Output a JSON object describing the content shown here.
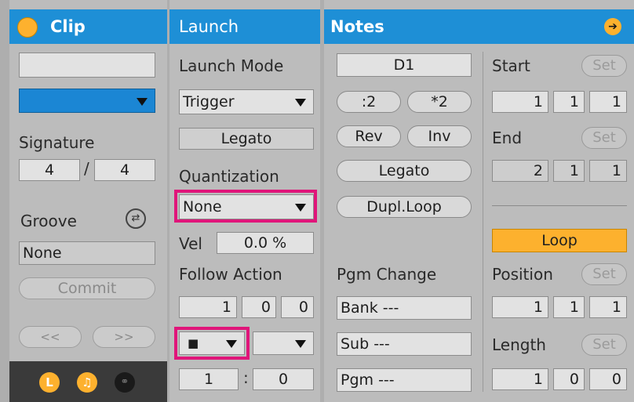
{
  "clip": {
    "title": "Clip",
    "name_value": "",
    "color_value": "",
    "signature_label": "Signature",
    "sig_num": "4",
    "sig_sep": "/",
    "sig_den": "4",
    "groove_label": "Groove",
    "groove_value": "None",
    "commit_label": "Commit",
    "nav_back": "<<",
    "nav_fwd": ">>",
    "footer_icons": [
      "loop-badge-icon",
      "audio-note-icon",
      "link-icon"
    ],
    "footer_l": "L"
  },
  "launch": {
    "title": "Launch",
    "mode_label": "Launch Mode",
    "mode_value": "Trigger",
    "legato_label": "Legato",
    "quant_label": "Quantization",
    "quant_value": "None",
    "vel_label": "Vel",
    "vel_value": "0.0 %",
    "follow_label": "Follow Action",
    "follow_bar": "1",
    "follow_beat": "0",
    "follow_six": "0",
    "action_a": "■",
    "action_b": "",
    "chance_a": "1",
    "chance_sep": ":",
    "chance_b": "0"
  },
  "notes": {
    "title": "Notes",
    "key_value": "D1",
    "half_label": ":2",
    "double_label": "*2",
    "rev_label": "Rev",
    "inv_label": "Inv",
    "legato_label": "Legato",
    "dupl_label": "Dupl.Loop",
    "pgm_change_label": "Pgm Change",
    "bank_value": "Bank ---",
    "sub_value": "Sub ---",
    "pgm_value": "Pgm ---",
    "start_label": "Start",
    "set_label": "Set",
    "start_vals": [
      "1",
      "1",
      "1"
    ],
    "end_label": "End",
    "end_vals": [
      "2",
      "1",
      "1"
    ],
    "loop_label": "Loop",
    "position_label": "Position",
    "position_vals": [
      "1",
      "1",
      "1"
    ],
    "length_label": "Length",
    "length_vals": [
      "1",
      "0",
      "0"
    ]
  },
  "colors": {
    "header_blue": "#1e8fd6",
    "accent_orange": "#fdb12e",
    "highlight_pink": "#e0157a"
  }
}
